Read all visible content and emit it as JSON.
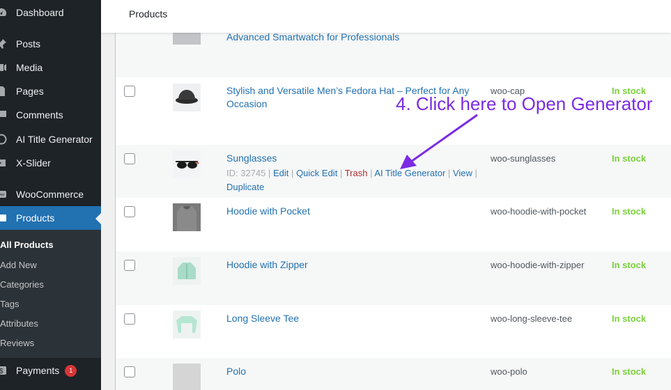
{
  "sidebar": {
    "dashboard": "Dashboard",
    "posts": "Posts",
    "media": "Media",
    "pages": "Pages",
    "comments": "Comments",
    "ai_title": "AI Title Generator",
    "xslider": "X-Slider",
    "woocommerce": "WooCommerce",
    "products": "Products",
    "submenu": {
      "all_products": "All Products",
      "add_new": "Add New",
      "categories": "Categories",
      "tags": "Tags",
      "attributes": "Attributes",
      "reviews": "Reviews"
    },
    "payments": "Payments",
    "payments_badge": "1"
  },
  "topbar": {
    "title": "Products"
  },
  "rows": [
    {
      "name": "Advanced Smartwatch for Professionals",
      "sku": "",
      "stock": ""
    },
    {
      "name": "Stylish and Versatile Men’s Fedora Hat – Perfect for Any Occasion",
      "sku": "woo-cap",
      "stock": "In stock"
    },
    {
      "name": "Sunglasses",
      "sku": "woo-sunglasses",
      "stock": "In stock",
      "actions": {
        "id": "ID: 32745",
        "edit": "Edit",
        "quick_edit": "Quick Edit",
        "trash": "Trash",
        "ai_title": "AI Title Generator",
        "view": "View",
        "duplicate": "Duplicate"
      }
    },
    {
      "name": "Hoodie with Pocket",
      "sku": "woo-hoodie-with-pocket",
      "stock": "In stock"
    },
    {
      "name": "Hoodie with Zipper",
      "sku": "woo-hoodie-with-zipper",
      "stock": "In stock"
    },
    {
      "name": "Long Sleeve Tee",
      "sku": "woo-long-sleeve-tee",
      "stock": "In stock"
    },
    {
      "name": "Polo",
      "sku": "woo-polo",
      "stock": "In stock"
    }
  ],
  "annotation": {
    "text": "4. Click here to Open Generator",
    "color": "#7b2be3"
  },
  "colors": {
    "sidebar_bg": "#1d2327",
    "accent": "#2271b1",
    "in_stock": "#7ad03a",
    "trash": "#b32d2e"
  }
}
